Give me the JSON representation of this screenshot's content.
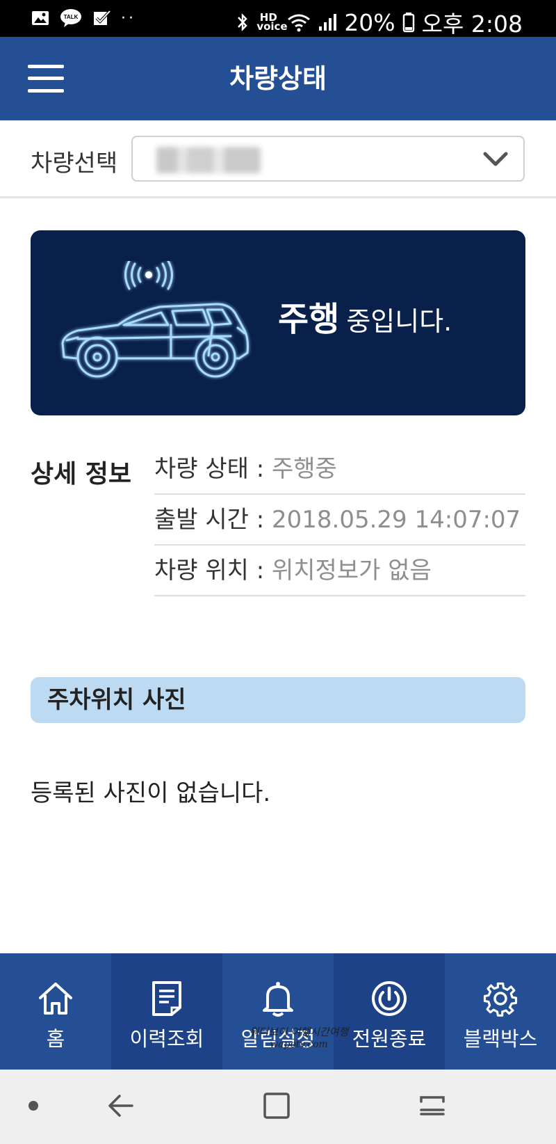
{
  "status_bar": {
    "battery": "20%",
    "time": "오후 2:08",
    "hd_voice": "HD voice"
  },
  "header": {
    "title": "차량상태"
  },
  "vehicle_select": {
    "label": "차량선택"
  },
  "status_card": {
    "status_strong": "주행",
    "status_rest": "중입니다."
  },
  "detail": {
    "title": "상세 정보",
    "rows": [
      {
        "key": "차량 상태 : ",
        "value": "주행중"
      },
      {
        "key": "출발 시간 : ",
        "value": "2018.05.29 14:07:07"
      },
      {
        "key": "차량 위치 : ",
        "value": "위치정보가 없음"
      }
    ]
  },
  "parking_photo": {
    "title": "주차위치 사진",
    "empty_text": "등록된 사진이 없습니다."
  },
  "bottom_nav": {
    "items": [
      {
        "label": "홈",
        "icon": "home-icon"
      },
      {
        "label": "이력조회",
        "icon": "document-icon"
      },
      {
        "label": "알림설정",
        "icon": "bell-icon"
      },
      {
        "label": "전원종료",
        "icon": "power-icon"
      },
      {
        "label": "블랙박스",
        "icon": "gear-icon"
      }
    ]
  },
  "watermark": {
    "line1": "워터보이 여행시간여행",
    "line2": "wapotv.com"
  },
  "colors": {
    "header_bg": "#254f95",
    "card_bg": "#08204a",
    "photo_header_bg": "#bcdaf1",
    "nav_bg": "#254f95",
    "nav_alt_bg": "#1d4287"
  }
}
